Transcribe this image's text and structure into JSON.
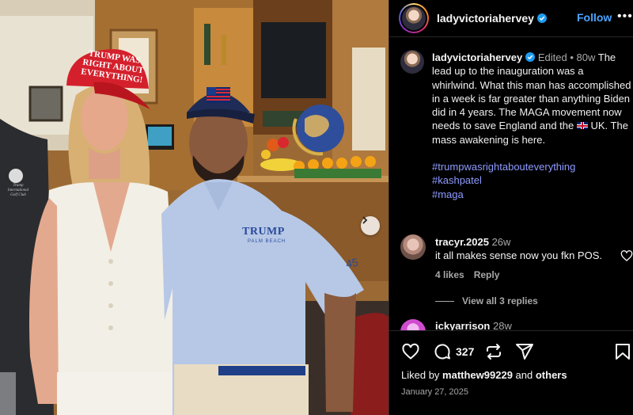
{
  "post": {
    "author": "ladyvictoriahervey",
    "follow_label": "Follow",
    "more_label": "•••",
    "caption": {
      "username": "ladyvictoriahervey",
      "edited": "Edited",
      "sep": "•",
      "age": "80w",
      "text_1": "The lead up to the inauguration was a whirlwind. What this man has accomplished in a week is far greater than anything Biden did in 4 years. The MAGA movement now needs to save England and the ",
      "text_2": " UK. The mass awakening is here.",
      "hashtags": [
        "#trumpwasrightabouteverything",
        "#kashpatel",
        "#maga"
      ]
    }
  },
  "photo": {
    "hat_text_line1": "TRUMP WAS",
    "hat_text_line2": "RIGHT ABOUT",
    "hat_text_line3": "EVERYTHING!",
    "shirt_logo": "TRUMP",
    "shirt_sub": "PALM BEACH",
    "sleeve_number": "45",
    "jacket_logo_line1": "Trump International",
    "jacket_logo_line2": "Golf Club"
  },
  "comments": [
    {
      "username": "tracyr.2025",
      "age": "26w",
      "text": "it all makes sense now you fkn POS.",
      "likes_label": "4 likes",
      "reply_label": "Reply",
      "view_replies": "View all 3 replies"
    },
    {
      "username": "ickyarrison",
      "age": "28w"
    }
  ],
  "actions": {
    "comment_count": "327",
    "liked_by_prefix": "Liked by ",
    "liked_by_user": "matthew99229",
    "liked_by_suffix": " and ",
    "liked_by_others": "others",
    "date": "January 27, 2025"
  },
  "colors": {
    "link_blue": "#4aa3ff",
    "hashtag": "#8e9bff",
    "muted": "#a8a8a8",
    "hat_red": "#d4202c",
    "shirt_blue": "#b7c8e6"
  },
  "icons": [
    "verified-icon",
    "more-icon",
    "heart-icon",
    "comment-icon",
    "repost-icon",
    "share-icon",
    "bookmark-icon",
    "chevron-right-icon"
  ]
}
